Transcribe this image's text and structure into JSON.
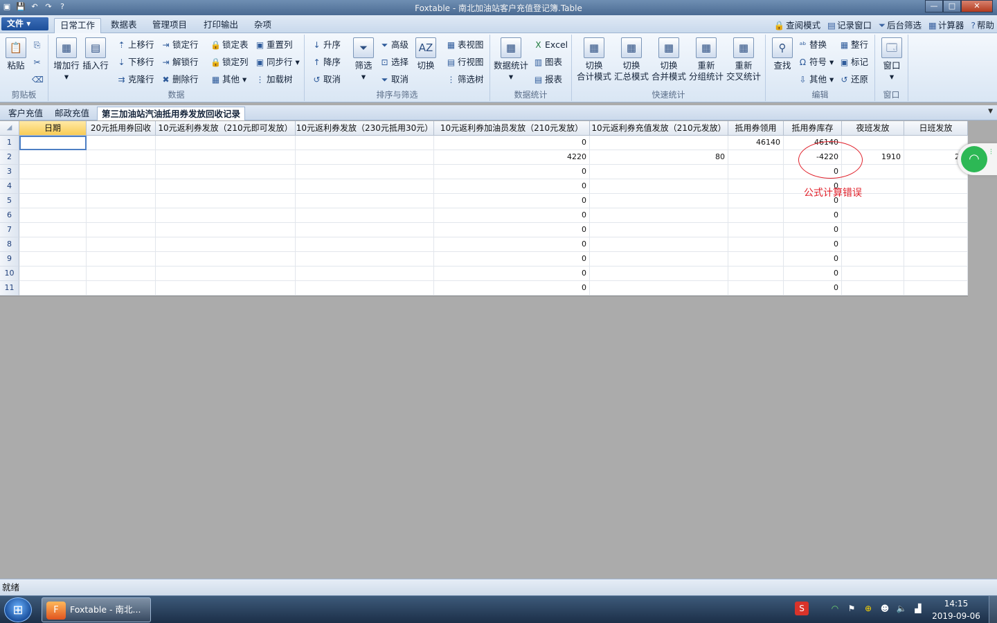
{
  "window": {
    "title": "Foxtable - 南北加油站客户充值登记簿.Table",
    "buttons": {
      "minimize": "—",
      "maximize": "□",
      "close": "✕"
    }
  },
  "quick_access": [
    "▣",
    "💾",
    "↶",
    "↷",
    "?"
  ],
  "menu": {
    "file": "文件",
    "tabs": [
      "日常工作",
      "数据表",
      "管理项目",
      "打印输出",
      "杂项"
    ],
    "right": [
      "查阅模式",
      "记录窗口",
      "后台筛选",
      "计算器",
      "帮助"
    ],
    "right_icons": [
      "🔒",
      "▤",
      "⏷",
      "▦",
      "?"
    ]
  },
  "ribbon": {
    "clipboard": {
      "label": "剪贴板",
      "paste": "粘贴"
    },
    "data": {
      "label": "数据",
      "add_row": "增加行",
      "insert_row": "插入行",
      "move_up": "上移行",
      "move_down": "下移行",
      "clone_row": "克隆行",
      "lock_row": "锁定行",
      "unlock_row": "解锁行",
      "delete_row": "删除行",
      "lock_table": "锁定表",
      "lock_col": "锁定列",
      "other": "其他",
      "reset_col": "重置列",
      "sync_row": "同步行",
      "load_tree": "加载树"
    },
    "sort": {
      "label": "排序与筛选",
      "asc": "升序",
      "desc": "降序",
      "cancel": "取消",
      "filter": "筛选",
      "advanced": "高级",
      "select": "选择",
      "cancel2": "取消",
      "switch": "切换",
      "table_view": "表视图",
      "row_view": "行视图",
      "filter_tree": "筛选树"
    },
    "stats": {
      "label": "数据统计",
      "data_stats": "数据统计",
      "excel": "Excel",
      "chart": "图表",
      "report": "报表"
    },
    "quick": {
      "label": "快速统计",
      "items": [
        [
          "切换",
          "合计模式"
        ],
        [
          "切换",
          "汇总模式"
        ],
        [
          "切换",
          "合并模式"
        ],
        [
          "重新",
          "分组统计"
        ],
        [
          "重新",
          "交叉统计"
        ]
      ]
    },
    "edit": {
      "label": "编辑",
      "find": "查找",
      "replace": "替换",
      "symbol": "符号",
      "other": "其他",
      "tidy": "整行",
      "mark": "标记",
      "restore": "还原"
    },
    "window": {
      "label": "窗口",
      "window": "窗口"
    }
  },
  "sheet_tabs": [
    "客户充值",
    "邮政充值",
    "第三加油站汽油抵用券发放回收记录"
  ],
  "grid": {
    "columns": [
      "日期",
      "20元抵用券回收",
      "10元返利券发放（210元即可发放）",
      "10元返利券发放（230元抵用30元）",
      "10元返利券加油员发放（210元发放）",
      "10元返利券充值发放（210元发放）",
      "抵用券领用",
      "抵用券库存",
      "夜班发放",
      "日班发放"
    ],
    "rows": [
      [
        "",
        "",
        "",
        "",
        "0",
        "",
        "46140",
        "46140",
        "",
        ""
      ],
      [
        "",
        "",
        "",
        "",
        "4220",
        "80",
        "",
        "-4220",
        "1910",
        "23"
      ],
      [
        "",
        "",
        "",
        "",
        "0",
        "",
        "",
        "0",
        "",
        ""
      ],
      [
        "",
        "",
        "",
        "",
        "0",
        "",
        "",
        "0",
        "",
        ""
      ],
      [
        "",
        "",
        "",
        "",
        "0",
        "",
        "",
        "0",
        "",
        ""
      ],
      [
        "",
        "",
        "",
        "",
        "0",
        "",
        "",
        "0",
        "",
        ""
      ],
      [
        "",
        "",
        "",
        "",
        "0",
        "",
        "",
        "0",
        "",
        ""
      ],
      [
        "",
        "",
        "",
        "",
        "0",
        "",
        "",
        "0",
        "",
        ""
      ],
      [
        "",
        "",
        "",
        "",
        "0",
        "",
        "",
        "0",
        "",
        ""
      ],
      [
        "",
        "",
        "",
        "",
        "0",
        "",
        "",
        "0",
        "",
        ""
      ],
      [
        "",
        "",
        "",
        "",
        "0",
        "",
        "",
        "0",
        "",
        ""
      ]
    ],
    "row_numbers": [
      "1",
      "2",
      "3",
      "4",
      "5",
      "6",
      "7",
      "8",
      "9",
      "10",
      "11"
    ]
  },
  "annotation": {
    "text": "公式计算错误",
    "color": "#e0202a"
  },
  "status": {
    "text": "就绪"
  },
  "taskbar": {
    "start": "⊞",
    "task_label": "Foxtable - 南北...",
    "time": "14:15",
    "date": "2019-09-06"
  },
  "colors": {
    "accent": "#1d4f9a",
    "selected_header": "#f8cc56",
    "annotation": "#e0202a"
  }
}
